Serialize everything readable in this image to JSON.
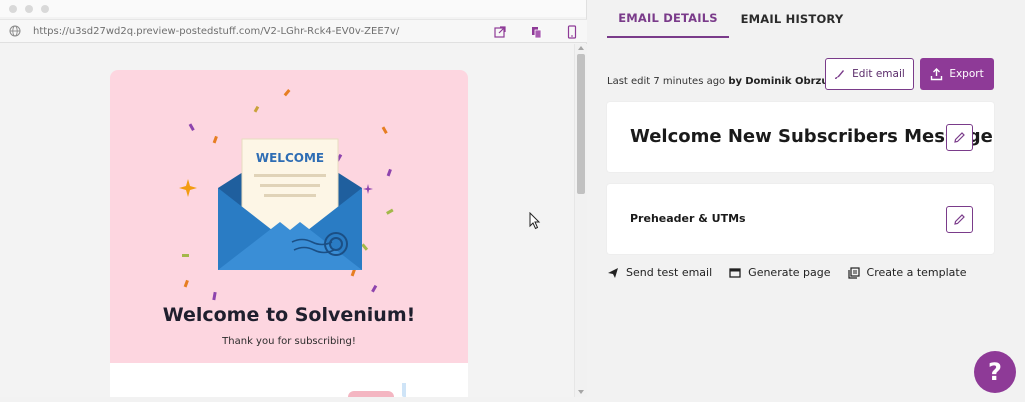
{
  "browser": {
    "url": "https://u3sd27wd2q.preview-postedstuff.com/V2-LGhr-Rck4-EV0v-ZEE7v/"
  },
  "email_preview": {
    "letter_label": "WELCOME",
    "heading": "Welcome to Solvenium!",
    "subheading": "Thank you for subscribing!",
    "background_color": "#fdd6e0"
  },
  "tabs": [
    {
      "label": "EMAIL DETAILS",
      "active": true
    },
    {
      "label": "EMAIL HISTORY",
      "active": false
    }
  ],
  "last_edit": {
    "prefix": "Last edit 7 minutes ago",
    "by": "by",
    "author": "Dominik Obrzut"
  },
  "buttons": {
    "edit_email": "Edit email",
    "export": "Export"
  },
  "cards": {
    "subject": "Welcome New Subscribers Message",
    "preheader": "Preheader & UTMs"
  },
  "actions": [
    {
      "label": "Send test email",
      "icon": "paper-plane-icon"
    },
    {
      "label": "Generate page",
      "icon": "page-icon"
    },
    {
      "label": "Create a template",
      "icon": "template-icon"
    }
  ],
  "help": {
    "label": "?"
  },
  "colors": {
    "accent": "#8e3a97",
    "accent_dark": "#7a3b8a"
  }
}
